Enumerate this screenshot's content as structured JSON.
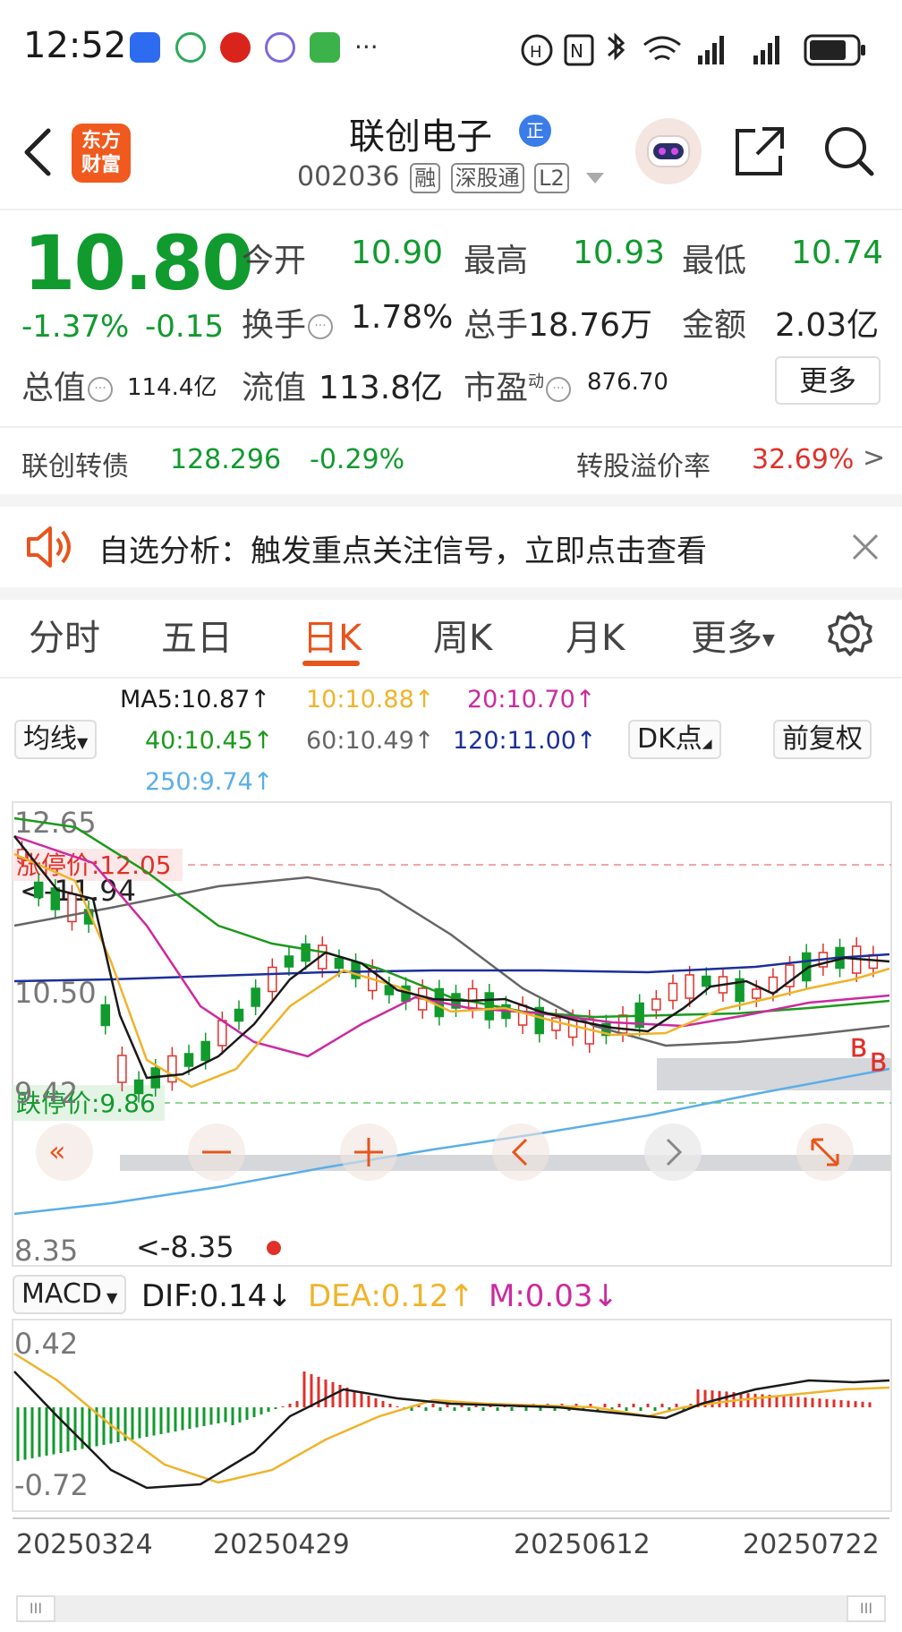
{
  "status_bar": {
    "time": "12:52",
    "more": "···"
  },
  "header": {
    "logo_text_1": "东方",
    "logo_text_2": "财富",
    "stock_name": "联创电子",
    "zheng_badge": "正",
    "stock_code": "002036",
    "tags": [
      "融",
      "深股通",
      "L2"
    ]
  },
  "quote": {
    "price": "10.80",
    "change_pct": "-1.37%",
    "change_amt": "-0.15",
    "open_label": "今开",
    "open_value": "10.90",
    "high_label": "最高",
    "high_value": "10.93",
    "low_label": "最低",
    "low_value": "10.74",
    "turnover_label": "换手",
    "turnover_value": "1.78%",
    "volume_label": "总手",
    "volume_value": "18.76万",
    "amount_label": "金额",
    "amount_value": "2.03亿",
    "mktcap_label": "总值",
    "mktcap_value": "114.4亿",
    "float_label": "流值",
    "float_value": "113.8亿",
    "pe_label": "市盈",
    "pe_sup": "动",
    "pe_value": "876.70",
    "more_button": "更多"
  },
  "bond": {
    "name": "联创转债",
    "price": "128.296",
    "change": "-0.29%",
    "premium_label": "转股溢价率",
    "premium_value": "32.69%",
    "arrow": ">"
  },
  "notice": {
    "text": "自选分析：触发重点关注信号，立即点击查看"
  },
  "tabs": {
    "items": [
      "分时",
      "五日",
      "日K",
      "周K",
      "月K",
      "更多"
    ],
    "active": "日K"
  },
  "ma": {
    "ma5": "MA5:10.87↑",
    "ma10": "10:10.88↑",
    "ma20": "20:10.70↑",
    "ma40": "40:10.45↑",
    "ma60": "60:10.49↑",
    "ma120": "120:11.00↑",
    "ma250": "250:9.74↑",
    "mode_button": "均线",
    "dk_button": "DK点",
    "adjust_button": "前复权"
  },
  "kline": {
    "y_labels": [
      "12.65",
      "10.50",
      "9.42",
      "8.35"
    ],
    "limit_up": "涨停价:12.05",
    "limit_down": "跌停价:9.86",
    "max_marker": "<-11.94",
    "min_marker": "<-8.35",
    "signal_marks": [
      "B",
      "B"
    ]
  },
  "macd": {
    "selector": "MACD",
    "dif": "DIF:0.14↓",
    "dea": "DEA:0.12↑",
    "m": "M:0.03↓",
    "y_labels": [
      "0.42",
      "-0.72"
    ]
  },
  "x_axis": {
    "dates": [
      "20250324",
      "20250429",
      "20250612",
      "20250722"
    ]
  },
  "scroll": {
    "left_handle": "III",
    "right_handle": "III"
  },
  "colors": {
    "up": "#e0302a",
    "down": "#119a2e",
    "accent": "#e8541c",
    "ma5": "#1a1a1a",
    "ma10": "#f0b32a",
    "ma20": "#cc2aa0",
    "ma40": "#1c9a1c",
    "ma60": "#666666",
    "ma120": "#1c2f9a",
    "ma250": "#5aaee8"
  }
}
